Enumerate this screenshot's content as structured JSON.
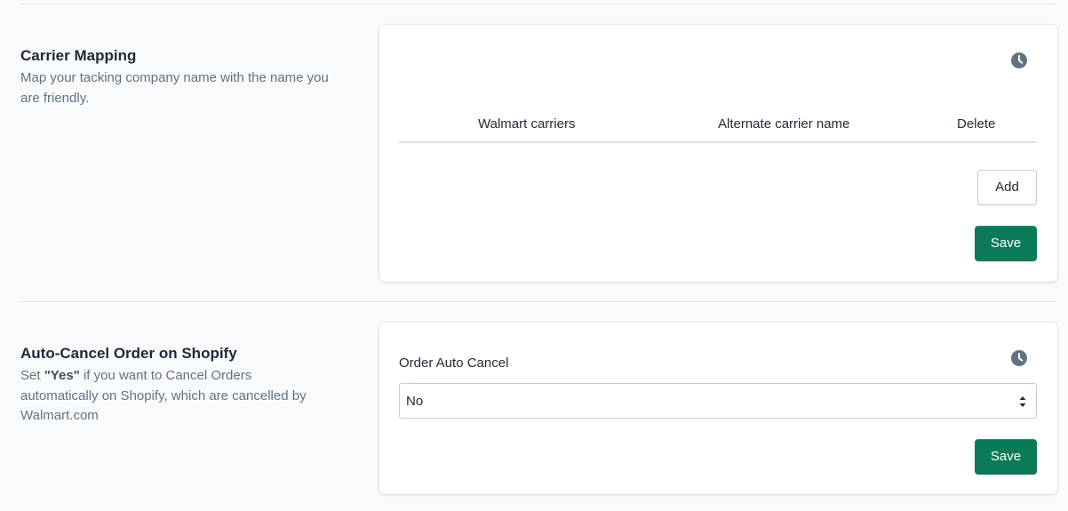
{
  "carrier_mapping": {
    "title": "Carrier Mapping",
    "description": "Map your tacking company name with the name you are friendly.",
    "columns": [
      "Walmart carriers",
      "Alternate carrier name",
      "Delete"
    ],
    "add_label": "Add",
    "save_label": "Save",
    "icon": "clock-icon"
  },
  "auto_cancel": {
    "title": "Auto-Cancel Order on Shopify",
    "description_prefix": "Set ",
    "description_bold": "\"Yes\"",
    "description_suffix": " if you want to Cancel Orders automatically on Shopify, which are cancelled by Walmart.com",
    "field_label": "Order Auto Cancel",
    "select_value": "No",
    "save_label": "Save",
    "icon": "clock-icon"
  },
  "colors": {
    "primary": "#0a7a59",
    "text": "#212b36",
    "muted": "#637381",
    "border": "#c4cdd5"
  }
}
